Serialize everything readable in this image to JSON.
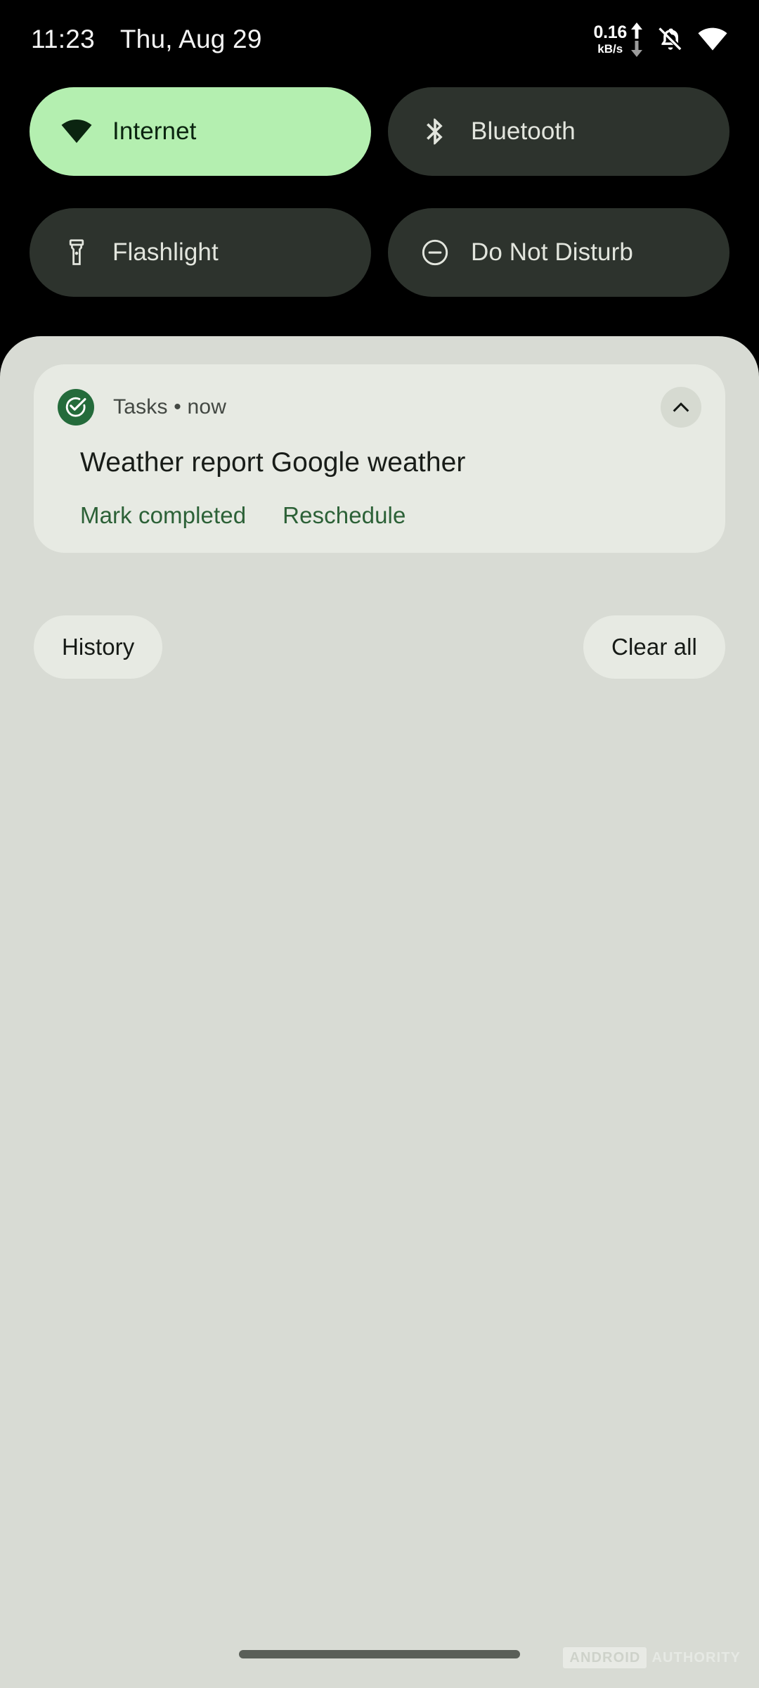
{
  "status_bar": {
    "clock": "11:23",
    "date": "Thu, Aug 29",
    "network_speed_value": "0.16",
    "network_speed_unit": "kB/s",
    "icons": [
      "upload-arrow-icon",
      "download-arrow-icon",
      "ringer-vibrate-off-icon",
      "wifi-icon"
    ]
  },
  "quick_settings": {
    "tiles": [
      {
        "label": "Internet",
        "icon": "wifi-icon",
        "state": "on"
      },
      {
        "label": "Bluetooth",
        "icon": "bluetooth-icon",
        "state": "off"
      },
      {
        "label": "Flashlight",
        "icon": "flashlight-icon",
        "state": "off"
      },
      {
        "label": "Do Not Disturb",
        "icon": "do-not-disturb-icon",
        "state": "off"
      }
    ]
  },
  "notification": {
    "app_name": "Tasks",
    "time": "now",
    "header": "Tasks • now",
    "title": "Weather report Google weather",
    "app_icon": "tasks-check-circle-icon",
    "collapse_icon": "chevron-up-icon",
    "actions": [
      {
        "label": "Mark completed"
      },
      {
        "label": "Reschedule"
      }
    ]
  },
  "shade_footer": {
    "history_label": "History",
    "clear_all_label": "Clear all"
  },
  "watermark": {
    "badge": "ANDROID",
    "text": "AUTHORITY"
  },
  "colors": {
    "screen_background": "#000000",
    "shade_background": "#D8DBD4",
    "card_background": "#E7EAE3",
    "tile_off": "#2D332D",
    "tile_on": "#B4EFB0",
    "tile_on_foreground": "#0B2410",
    "accent_green": "#2C6137",
    "app_icon_green": "#246B3B",
    "nav_pill": "#5A5F58"
  }
}
